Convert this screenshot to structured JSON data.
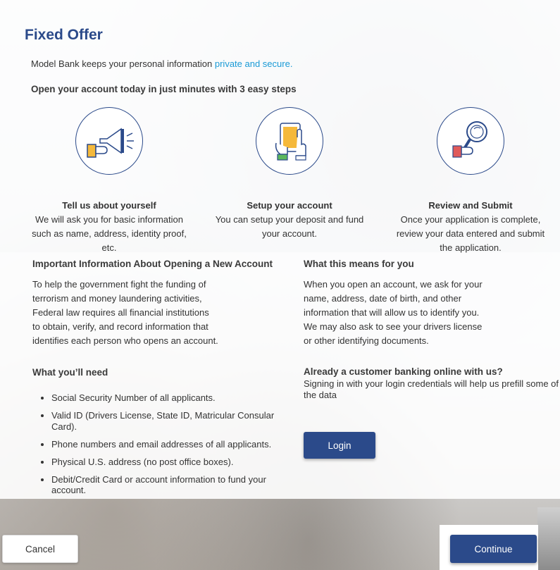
{
  "page": {
    "title": "Fixed Offer",
    "privacy_prefix": "Model Bank keeps your personal information ",
    "privacy_link": "private and secure.",
    "steps_heading": "Open your account today in just minutes with 3 easy steps"
  },
  "steps": [
    {
      "icon": "megaphone-icon",
      "title": "Tell us about yourself",
      "lines": [
        "We will ask you for basic information",
        "such as name, address, identity proof,",
        "etc."
      ]
    },
    {
      "icon": "tablet-icon",
      "title": "Setup your account",
      "lines": [
        "You can setup your deposit and fund",
        "your account."
      ]
    },
    {
      "icon": "magnifier-icon",
      "title": "Review and Submit",
      "lines": [
        "Once your application is complete,",
        "review your data entered and submit",
        "the application."
      ]
    }
  ],
  "important": {
    "title": "Important Information About Opening a New Account",
    "lines": [
      "To help the government fight the funding of",
      "terrorism and money laundering activities,",
      "Federal law requires all financial institutions",
      "to obtain, verify, and record information that",
      "identifies each person who opens an account."
    ]
  },
  "means": {
    "title": "What this means for you",
    "lines": [
      "When you open an account, we ask for your",
      "name, address, date of birth, and other",
      "information that will allow us to identify you.",
      "We may also ask to see your drivers license",
      "or other identifying documents."
    ]
  },
  "need": {
    "title": "What you’ll need",
    "items": [
      "Social Security Number of all applicants.",
      "Valid ID (Drivers License, State ID, Matricular Consular Card).",
      "Phone numbers and email addresses of all applicants.",
      "Physical U.S. address (no post office boxes).",
      "Debit/Credit Card or account information to fund your account."
    ]
  },
  "existing": {
    "title": "Already a customer banking online with us?",
    "line1": "Signing in with your login credentials will help us prefill some of",
    "line2": "the data",
    "login_label": "Login"
  },
  "footer": {
    "cancel_label": "Cancel",
    "continue_label": "Continue"
  },
  "colors": {
    "primary": "#2b4a8a",
    "link": "#1a9ad6",
    "accent_yellow": "#f5b93b",
    "accent_green": "#5cb85c",
    "accent_red": "#e05a5a"
  }
}
